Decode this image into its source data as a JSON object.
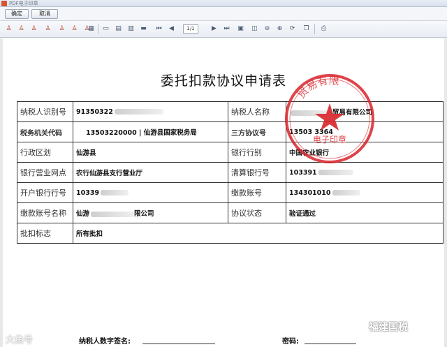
{
  "window": {
    "title": "PDF电子印章"
  },
  "buttons": {
    "ok_label": "确定",
    "cancel_label": "取消"
  },
  "toolbar": {
    "stamp_icons": [
      "stamp-icon",
      "stamp-icon",
      "stamp-icon",
      "stamp-icon",
      "stamp-icon",
      "stamp-icon",
      "stamp-icon",
      "stamp-icon"
    ],
    "page_indicator": "1/1"
  },
  "document": {
    "title": "委托扣款协议申请表",
    "rows": [
      {
        "l1": "纳税人识别号",
        "v1": "91350322",
        "l2": "纳税人名称",
        "v2": "贸易有限公司"
      },
      {
        "l1": "税务机关代码",
        "v1": "13503220000  |  仙游县国家税务局",
        "l2": "三方协议号",
        "v2": "13503 3364"
      },
      {
        "l1": "行政区划",
        "v1": "仙游县",
        "l2": "银行行别",
        "v2": "中国农业银行"
      },
      {
        "l1": "银行营业网点",
        "v1": "农行仙游县支行营业厅",
        "l2": "清算银行号",
        "v2": "103391"
      },
      {
        "l1": "开户银行行号",
        "v1": "10339",
        "l2": "缴款账号",
        "v2": "134301010"
      },
      {
        "l1": "缴款账号名称",
        "v1": "仙游",
        "v1b": "限公司",
        "l2": "协议状态",
        "v2": "验证通过"
      },
      {
        "l1": "批扣标志",
        "v1": "所有批扣"
      }
    ],
    "seal": {
      "text_top": "贸易有限",
      "text_bottom": "电子印章"
    },
    "footer": {
      "signature_label": "纳税人数字签名:",
      "password_label": "密码:"
    }
  },
  "watermarks": {
    "left": "大鱼号",
    "right": "福建国税"
  }
}
